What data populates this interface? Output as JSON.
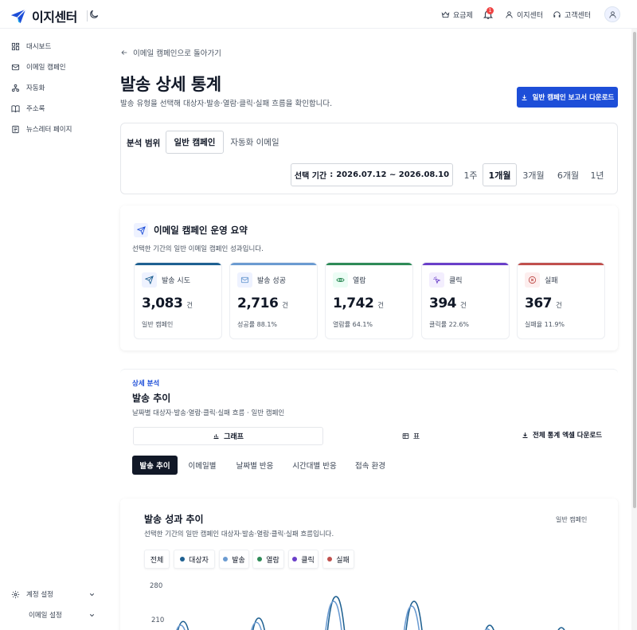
{
  "header": {
    "brand": "이지센터",
    "pricing": "요금제",
    "notifications_count": "1",
    "my_center": "이지센터",
    "support": "고객센터"
  },
  "sidebar": {
    "items": [
      {
        "label": "대시보드",
        "icon": "dashboard-icon"
      },
      {
        "label": "이메일 캠페인",
        "icon": "mail-icon"
      },
      {
        "label": "자동화",
        "icon": "automation-icon"
      },
      {
        "label": "주소록",
        "icon": "book-icon"
      },
      {
        "label": "뉴스레터 페이지",
        "icon": "newspaper-icon"
      }
    ],
    "account_settings": "계정 설정",
    "email_settings": "이메일 설정"
  },
  "page": {
    "back_link": "이메일 캠페인으로 돌아가기",
    "title": "발송 상세 통계",
    "subtitle": "발송 유형을 선택해 대상자·발송·열람·클릭·실패 흐름을 확인합니다.",
    "download_report": "일반 캠페인 보고서 다운로드"
  },
  "filter": {
    "scope_label": "분석 범위",
    "scope_tabs": [
      "일반 캠페인",
      "자동화 이메일"
    ],
    "scope_selected": "일반 캠페인",
    "period_label": "선택 기간",
    "period_value": "2026.07.12 ~ 2026.08.10",
    "period_options": [
      "1주",
      "1개월",
      "3개월",
      "6개월",
      "1년"
    ],
    "period_selected": "1개월"
  },
  "summary": {
    "title": "이메일 캠페인 운영 요약",
    "subtitle": "선택한 기간의 일반 이메일 캠페인 성과입니다.",
    "kpis": [
      {
        "label": "발송 시도",
        "value": "3,083",
        "unit": "건",
        "note": "일반 캠페인",
        "color": "#1e6091",
        "icon": "send-icon"
      },
      {
        "label": "발송 성공",
        "value": "2,716",
        "unit": "건",
        "note": "성공률 88.1%",
        "color": "#6b9bd1",
        "icon": "mail-icon"
      },
      {
        "label": "열람",
        "value": "1,742",
        "unit": "건",
        "note": "열람률 64.1%",
        "color": "#2e8b57",
        "icon": "eye-icon"
      },
      {
        "label": "클릭",
        "value": "394",
        "unit": "건",
        "note": "클릭률 22.6%",
        "color": "#6a3fc9",
        "icon": "click-icon"
      },
      {
        "label": "실패",
        "value": "367",
        "unit": "건",
        "note": "실패율 11.9%",
        "color": "#c0504d",
        "icon": "x-circle-icon"
      }
    ]
  },
  "detail": {
    "eyebrow": "상세 분석",
    "title": "발송 추이",
    "subtitle": "날짜별 대상자·발송·열람·클릭·실패 흐름 · 일반 캠페인",
    "view_tabs": [
      "그래프",
      "표"
    ],
    "view_selected": "그래프",
    "excel_download": "전체 통계 엑셀 다운로드",
    "sub_tabs": [
      "발송 추이",
      "이메일별",
      "날짜별 반응",
      "시간대별 반응",
      "접속 환경"
    ],
    "sub_selected": "발송 추이"
  },
  "chart": {
    "title": "발송 성과 추이",
    "badge": "일반 캠페인",
    "subtitle": "선택한 기간의 일반 캠페인 대상자·발송·열람·클릭·실패 흐름입니다.",
    "legend_all": "전체",
    "legend": [
      {
        "name": "대상자",
        "color": "#1e6091"
      },
      {
        "name": "발송",
        "color": "#6b9bd1"
      },
      {
        "name": "열람",
        "color": "#2e8b57"
      },
      {
        "name": "클릭",
        "color": "#6a3fc9"
      },
      {
        "name": "실패",
        "color": "#c0504d"
      }
    ],
    "y_ticks": [
      "280",
      "210"
    ]
  },
  "chart_data": {
    "type": "line",
    "title": "발송 성과 추이",
    "series": [
      {
        "name": "대상자"
      },
      {
        "name": "발송"
      },
      {
        "name": "열람"
      },
      {
        "name": "클릭"
      },
      {
        "name": "실패"
      }
    ],
    "y_ticks": [
      210,
      280
    ],
    "peaks_visible": [
      {
        "series": "대상자",
        "values": [
          208,
          215,
          260,
          250,
          200,
          195
        ]
      },
      {
        "series": "발송",
        "values": [
          200,
          206,
          250,
          240,
          192,
          186
        ]
      }
    ],
    "grid": false
  }
}
